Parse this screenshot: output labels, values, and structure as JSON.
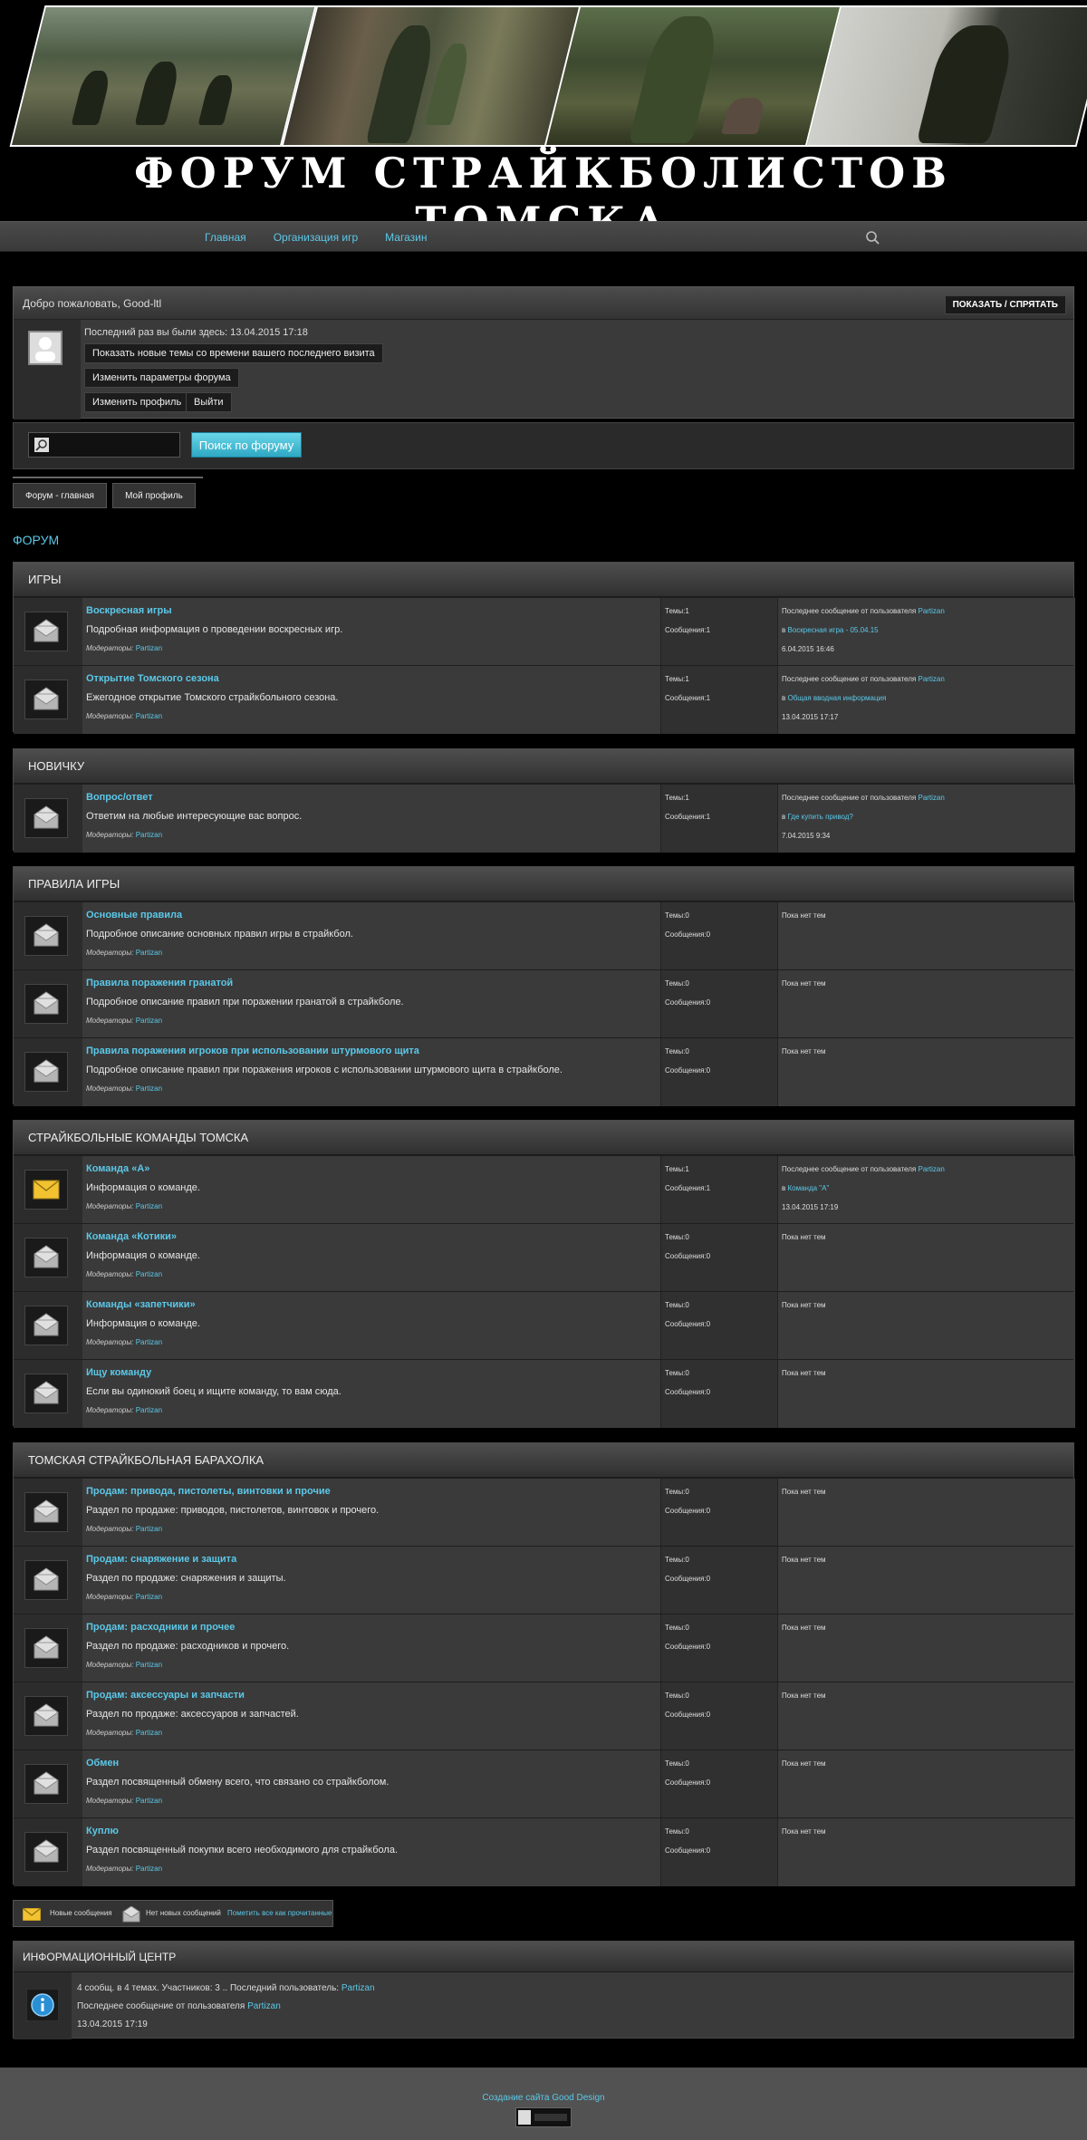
{
  "site": {
    "title": "ФОРУМ СТРАЙКБОЛИСТОВ ТОМСКА"
  },
  "nav": {
    "items": [
      "Главная",
      "Организация игр",
      "Магазин"
    ]
  },
  "welcome": {
    "greeting": "Добро пожаловать, Good-ltl",
    "toggle": "ПОКАЗАТЬ / СПРЯТАТЬ",
    "last_visit": "Последний раз вы были здесь: 13.04.2015 17:18",
    "buttons": [
      "Показать новые темы со времени вашего последнего визита",
      "Изменить параметры форума",
      "Изменить профиль",
      "Выйти"
    ]
  },
  "search": {
    "button": "Поиск по форуму"
  },
  "tabs": [
    "Форум - главная",
    "Мой профиль"
  ],
  "forum_label": "ФОРУМ",
  "categories": [
    {
      "name": "ИГРЫ",
      "forums": [
        {
          "title": "Воскресная игры",
          "desc": "Подробная информация о проведении воскресных игр.",
          "mods": "Модераторы:",
          "mod": "Partizan",
          "topics": "Темы:1",
          "posts": "Сообщения:1",
          "last1": "Последнее сообщение от пользователя",
          "last1u": "Partizan",
          "last2p": "в",
          "last2": "Воскресная игра - 05.04.15",
          "last3": "6.04.2015 16:46",
          "newmsg": false
        },
        {
          "title": "Открытие Томского сезона",
          "desc": "Ежегодное открытие Томского страйкбольного сезона.",
          "mods": "Модераторы:",
          "mod": "Partizan",
          "topics": "Темы:1",
          "posts": "Сообщения:1",
          "last1": "Последнее сообщение от пользователя",
          "last1u": "Partizan",
          "last2p": "в",
          "last2": "Общая вводная информация",
          "last3": "13.04.2015 17:17",
          "newmsg": false
        }
      ]
    },
    {
      "name": "НОВИЧКУ",
      "forums": [
        {
          "title": "Вопрос/ответ",
          "desc": "Ответим на любые интересующие вас вопрос.",
          "mods": "Модераторы:",
          "mod": "Partizan",
          "topics": "Темы:1",
          "posts": "Сообщения:1",
          "last1": "Последнее сообщение от пользователя",
          "last1u": "Partizan",
          "last2p": "в",
          "last2": "Где купить привод?",
          "last3": "7.04.2015 9:34",
          "newmsg": false
        }
      ]
    },
    {
      "name": "ПРАВИЛА ИГРЫ",
      "forums": [
        {
          "title": "Основные правила",
          "desc": "Подробное описание основных правил игры в страйкбол.",
          "mods": "Модераторы:",
          "mod": "Partizan",
          "topics": "Темы:0",
          "posts": "Сообщения:0",
          "none": "Пока нет тем",
          "newmsg": false
        },
        {
          "title": "Правила поражения гранатой",
          "desc": "Подробное описание правил при поражении гранатой в страйкболе.",
          "mods": "Модераторы:",
          "mod": "Partizan",
          "topics": "Темы:0",
          "posts": "Сообщения:0",
          "none": "Пока нет тем",
          "newmsg": false
        },
        {
          "title": "Правила поражения игроков при использовании штурмового щита",
          "desc": "Подробное описание правил при поражения игроков с использовании штурмового щита в страйкболе.",
          "mods": "Модераторы:",
          "mod": "Partizan",
          "topics": "Темы:0",
          "posts": "Сообщения:0",
          "none": "Пока нет тем",
          "newmsg": false
        }
      ]
    },
    {
      "name": "СТРАЙКБОЛЬНЫЕ КОМАНДЫ ТОМСКА",
      "forums": [
        {
          "title": "Команда «А»",
          "desc": "Информация о команде.",
          "mods": "Модераторы:",
          "mod": "Partizan",
          "topics": "Темы:1",
          "posts": "Сообщения:1",
          "last1": "Последнее сообщение от пользователя",
          "last1u": "Partizan",
          "last2p": "в",
          "last2": "Команда \"А\"",
          "last3": "13.04.2015 17:19",
          "newmsg": true
        },
        {
          "title": "Команда «Котики»",
          "desc": "Информация о команде.",
          "mods": "Модераторы:",
          "mod": "Partizan",
          "topics": "Темы:0",
          "posts": "Сообщения:0",
          "none": "Пока нет тем",
          "newmsg": false
        },
        {
          "title": "Команды «запетчики»",
          "desc": "Информация о команде.",
          "mods": "Модераторы:",
          "mod": "Partizan",
          "topics": "Темы:0",
          "posts": "Сообщения:0",
          "none": "Пока нет тем",
          "newmsg": false
        },
        {
          "title": "Ищу команду",
          "desc": "Если вы одинокий боец и ищите команду, то вам сюда.",
          "mods": "Модераторы:",
          "mod": "Partizan",
          "topics": "Темы:0",
          "posts": "Сообщения:0",
          "none": "Пока нет тем",
          "newmsg": false
        }
      ]
    },
    {
      "name": "ТОМСКАЯ СТРАЙКБОЛЬНАЯ БАРАХОЛКА",
      "forums": [
        {
          "title": "Продам: привода, пистолеты, винтовки и прочие",
          "desc": "Раздел по продаже: приводов, пистолетов, винтовок и прочего.",
          "mods": "Модераторы:",
          "mod": "Partizan",
          "topics": "Темы:0",
          "posts": "Сообщения:0",
          "none": "Пока нет тем",
          "newmsg": false
        },
        {
          "title": "Продам: снаряжение и защита",
          "desc": "Раздел по продаже: снаряжения и защиты.",
          "mods": "Модераторы:",
          "mod": "Partizan",
          "topics": "Темы:0",
          "posts": "Сообщения:0",
          "none": "Пока нет тем",
          "newmsg": false
        },
        {
          "title": "Продам: расходники и прочее",
          "desc": "Раздел по продаже: расходников и прочего.",
          "mods": "Модераторы:",
          "mod": "Partizan",
          "topics": "Темы:0",
          "posts": "Сообщения:0",
          "none": "Пока нет тем",
          "newmsg": false
        },
        {
          "title": "Продам: аксессуары и запчасти",
          "desc": "Раздел по продаже: аксессуаров и запчастей.",
          "mods": "Модераторы:",
          "mod": "Partizan",
          "topics": "Темы:0",
          "posts": "Сообщения:0",
          "none": "Пока нет тем",
          "newmsg": false
        },
        {
          "title": "Обмен",
          "desc": "Раздел посвященный обмену всего, что связано со страйкболом.",
          "mods": "Модераторы:",
          "mod": "Partizan",
          "topics": "Темы:0",
          "posts": "Сообщения:0",
          "none": "Пока нет тем",
          "newmsg": false
        },
        {
          "title": "Куплю",
          "desc": "Раздел посвященный покупки всего необходимого для страйкбола.",
          "mods": "Модераторы:",
          "mod": "Partizan",
          "topics": "Темы:0",
          "posts": "Сообщения:0",
          "none": "Пока нет тем",
          "newmsg": false
        }
      ]
    }
  ],
  "legend": {
    "new": "Новые сообщения",
    "nonew": "Нет новых сообщений",
    "markread": "Пометить все как прочитанные"
  },
  "info": {
    "title": "ИНФОРМАЦИОННЫЙ ЦЕНТР",
    "line1": "4 сообщ. в 4 темах. Участников: 3 .. Последний пользователь:",
    "line1u": "Partizan",
    "line2": "Последнее сообщение от пользователя",
    "line2u": "Partizan",
    "line3": "13.04.2015 17:19"
  },
  "footer": {
    "link": "Создание сайта Good Design"
  },
  "colors": {
    "accent": "#5bc8e8",
    "bg": "#000000",
    "panel": "#3a3a3a"
  }
}
